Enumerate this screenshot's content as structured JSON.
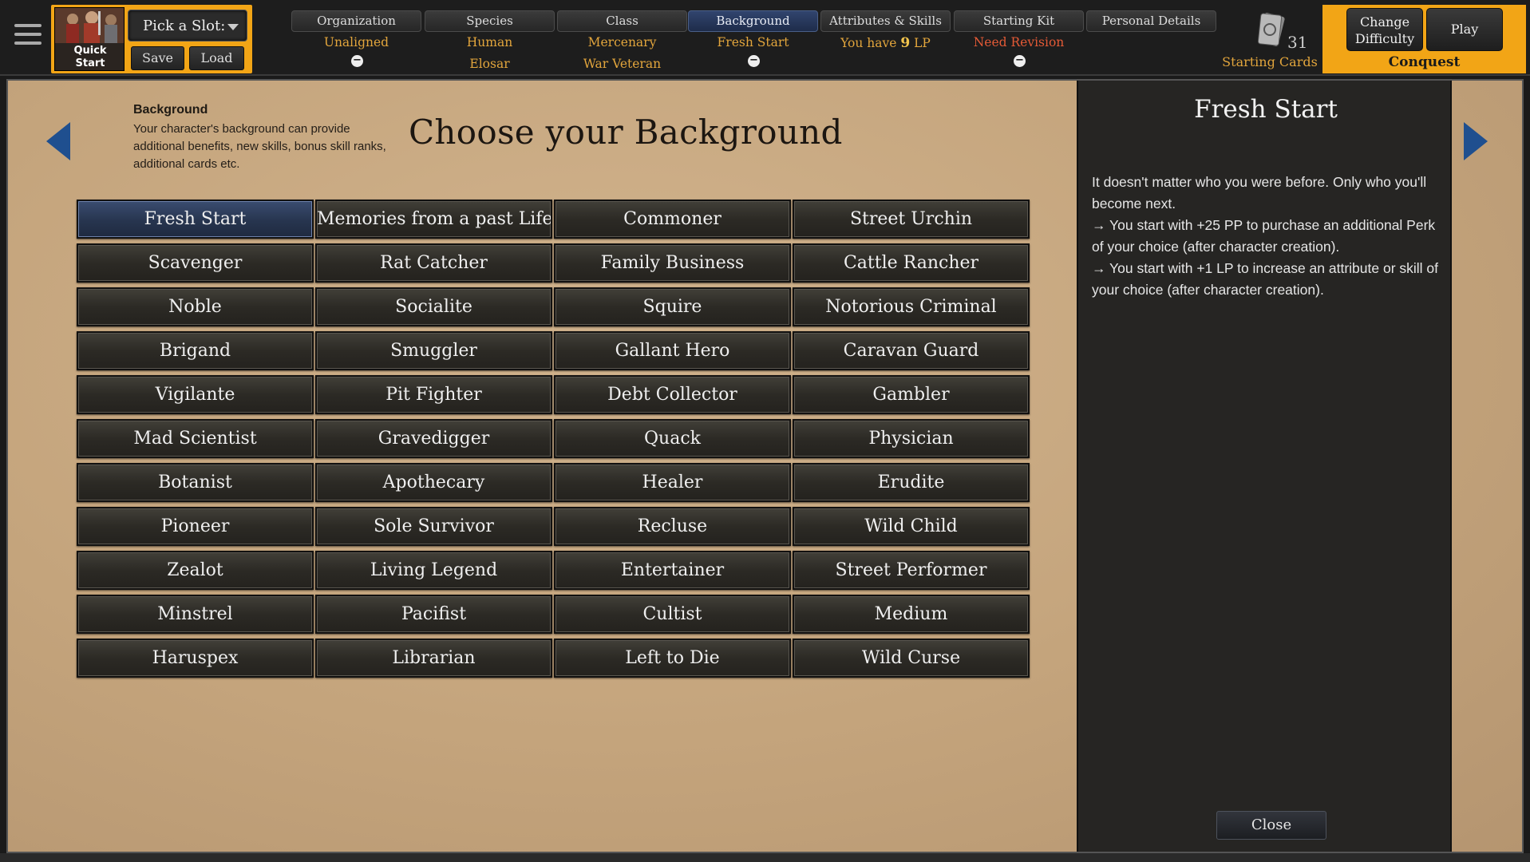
{
  "topbar": {
    "quick_start_label": "Quick\nStart",
    "slot_dropdown": "Pick a Slot:",
    "save_label": "Save",
    "load_label": "Load",
    "tabs": [
      {
        "label": "Organization",
        "line1": "Unaligned",
        "line2": "",
        "minus": true,
        "warn": false
      },
      {
        "label": "Species",
        "line1": "Human",
        "line2": "Elosar",
        "minus": false,
        "warn": false
      },
      {
        "label": "Class",
        "line1": "Mercenary",
        "line2": "War Veteran",
        "minus": false,
        "warn": false
      },
      {
        "label": "Background",
        "line1": "Fresh Start",
        "line2": "",
        "minus": true,
        "warn": false,
        "active": true
      },
      {
        "label": "Attributes & Skills",
        "line1_prefix": "You have ",
        "line1_big": "9",
        "line1_suffix": " LP",
        "minus": false
      },
      {
        "label": "Starting Kit",
        "line1": "Need Revision",
        "line2": "",
        "minus": true,
        "warn": true
      },
      {
        "label": "Personal Details",
        "line1": "",
        "line2": "",
        "minus": false
      }
    ],
    "cards_count": "31",
    "cards_label": "Starting Cards",
    "change_difficulty_label": "Change\nDifficulty",
    "play_label": "Play",
    "difficulty_name": "Conquest"
  },
  "main": {
    "info_title": "Background",
    "info_body": "Your character's background can provide additional benefits, new skills, bonus skill ranks, additional cards etc.",
    "heading": "Choose your Background",
    "selected_index": 0,
    "backgrounds": [
      "Fresh Start",
      "Memories from a past Life",
      "Commoner",
      "Street Urchin",
      "Scavenger",
      "Rat Catcher",
      "Family Business",
      "Cattle Rancher",
      "Noble",
      "Socialite",
      "Squire",
      "Notorious Criminal",
      "Brigand",
      "Smuggler",
      "Gallant Hero",
      "Caravan Guard",
      "Vigilante",
      "Pit Fighter",
      "Debt Collector",
      "Gambler",
      "Mad Scientist",
      "Gravedigger",
      "Quack",
      "Physician",
      "Botanist",
      "Apothecary",
      "Healer",
      "Erudite",
      "Pioneer",
      "Sole Survivor",
      "Recluse",
      "Wild Child",
      "Zealot",
      "Living Legend",
      "Entertainer",
      "Street Performer",
      "Minstrel",
      "Pacifist",
      "Cultist",
      "Medium",
      "Haruspex",
      "Librarian",
      "Left to Die",
      "Wild Curse"
    ]
  },
  "detail": {
    "title": "Fresh Start",
    "paragraphs": [
      "It doesn't matter who you were before. Only who you'll become next.",
      "→ You start with +25 PP to purchase an additional Perk of your choice (after character creation).",
      "→ You start with +1 LP to increase an attribute or skill of your choice (after character creation)."
    ],
    "close_label": "Close"
  },
  "colors": {
    "accent_orange": "#f2a516",
    "value_gold": "#e2a53c",
    "warn_red": "#e45a36",
    "arrow_blue": "#1f4f8f",
    "selected_blue": "#27354f"
  }
}
